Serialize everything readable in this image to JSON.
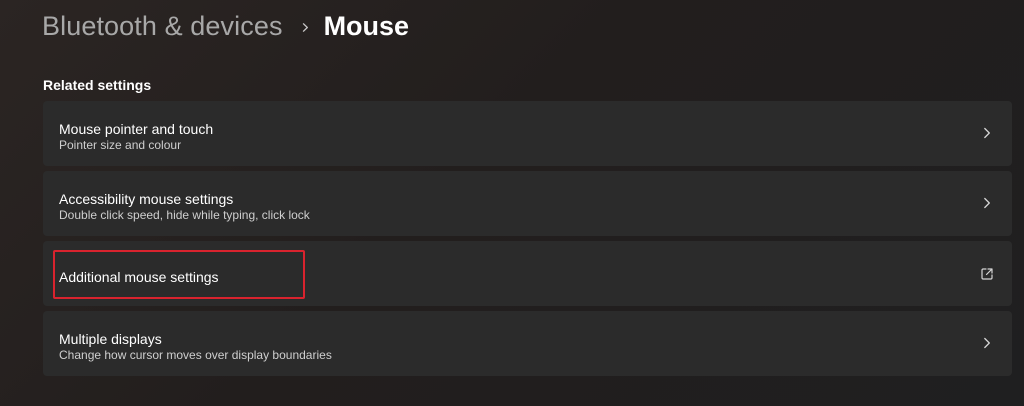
{
  "breadcrumb": {
    "parent": "Bluetooth & devices",
    "current": "Mouse"
  },
  "section": {
    "title": "Related settings"
  },
  "items": [
    {
      "title": "Mouse pointer and touch",
      "subtitle": "Pointer size and colour",
      "icon": "chevron-right-icon"
    },
    {
      "title": "Accessibility mouse settings",
      "subtitle": "Double click speed, hide while typing, click lock",
      "icon": "chevron-right-icon"
    },
    {
      "title": "Additional mouse settings",
      "icon": "open-external-icon"
    },
    {
      "title": "Multiple displays",
      "subtitle": "Change how cursor moves over display boundaries",
      "icon": "chevron-right-icon"
    }
  ],
  "colors": {
    "highlight": "#d9232e",
    "card": "#2b2b2b"
  }
}
